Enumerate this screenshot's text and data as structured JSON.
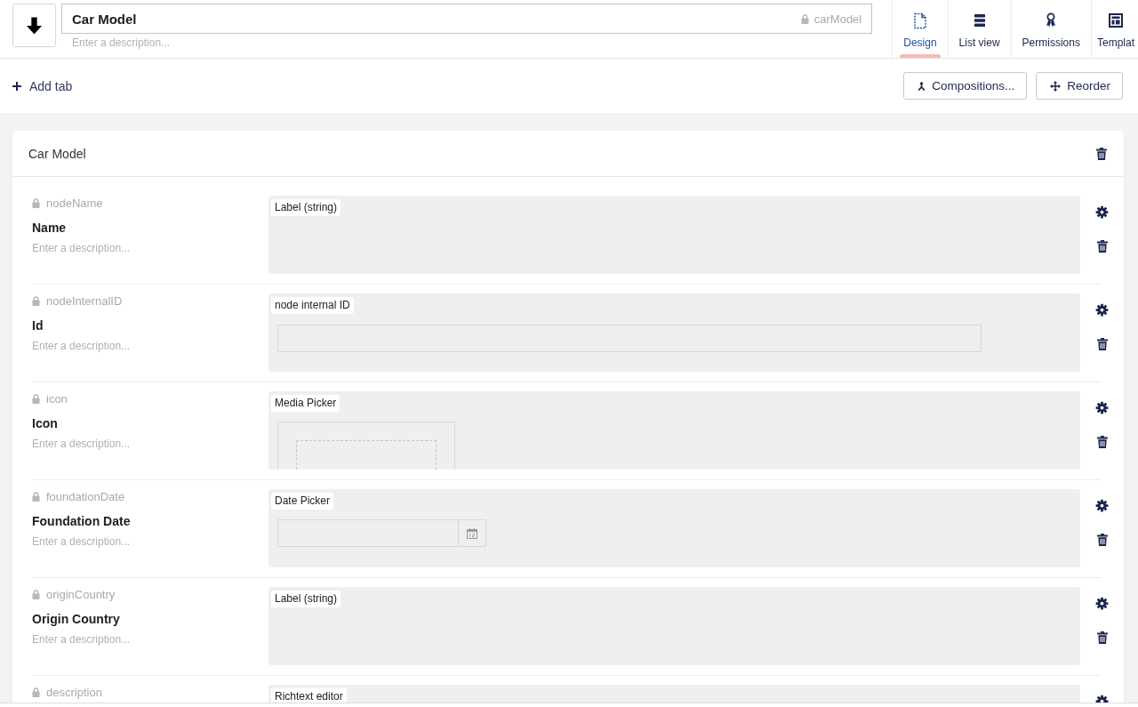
{
  "header": {
    "name_field": {
      "value": "Car Model"
    },
    "alias": {
      "text": "carModel",
      "locked": true
    },
    "description_field": {
      "placeholder": "Enter a description..."
    },
    "tabs": [
      {
        "kind": "design",
        "label": "Design",
        "selected": true
      },
      {
        "kind": "list_view",
        "label": "List view",
        "selected": false
      },
      {
        "kind": "permissions",
        "label": "Permissions",
        "selected": false
      },
      {
        "kind": "templates",
        "label": "Templat",
        "selected": false
      }
    ]
  },
  "toolbar": {
    "add_tab": "Add tab",
    "buttons": [
      {
        "kind": "compositions",
        "label": "Compositions..."
      },
      {
        "kind": "reorder",
        "label": "Reorder"
      }
    ]
  },
  "group": {
    "title": "Car Model",
    "properties": [
      {
        "alias": "nodeName",
        "locked": true,
        "name": "Name",
        "description_field": {
          "placeholder": "Enter a description..."
        },
        "editor": {
          "kind": "label",
          "label": "Label (string)"
        }
      },
      {
        "alias": "nodeInternalID",
        "locked": true,
        "name": "Id",
        "description_field": {
          "placeholder": "Enter a description..."
        },
        "editor": {
          "kind": "textbox",
          "label": "node internal ID"
        }
      },
      {
        "alias": "icon",
        "locked": true,
        "name": "Icon",
        "description_field": {
          "placeholder": "Enter a description..."
        },
        "editor": {
          "kind": "media",
          "label": "Media Picker"
        }
      },
      {
        "alias": "foundationDate",
        "locked": true,
        "name": "Foundation Date",
        "description_field": {
          "placeholder": "Enter a description..."
        },
        "editor": {
          "kind": "date",
          "label": "Date Picker"
        }
      },
      {
        "alias": "originCountry",
        "locked": true,
        "name": "Origin Country",
        "description_field": {
          "placeholder": "Enter a description..."
        },
        "editor": {
          "kind": "label",
          "label": "Label (string)"
        }
      },
      {
        "alias": "description",
        "locked": true,
        "editor": {
          "kind": "richtext",
          "label": "Richtext editor"
        }
      }
    ]
  }
}
